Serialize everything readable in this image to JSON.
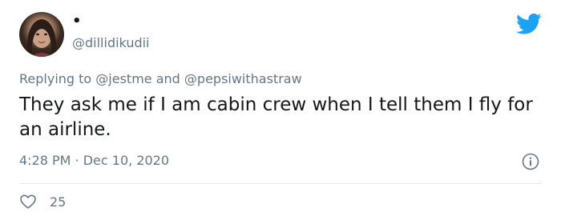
{
  "tweet": {
    "display_name": "•",
    "handle": "@dillidikudii",
    "reply": {
      "prefix": "Replying to ",
      "mention_1": "@jestme",
      "joiner": " and ",
      "mention_2": "@pepsiwithastraw"
    },
    "text": "They ask me if I am cabin crew when I tell them I fly for an airline.",
    "time": "4:28 PM",
    "separator": " · ",
    "date": "Dec 10, 2020",
    "likes": "25"
  },
  "icons": {
    "brand": "twitter-bird-icon",
    "info": "info-icon",
    "like": "heart-icon"
  },
  "colors": {
    "brand_blue": "#1da1f2",
    "secondary_text": "#657786",
    "primary_text": "#14171a",
    "divider": "#e1e8ed"
  }
}
